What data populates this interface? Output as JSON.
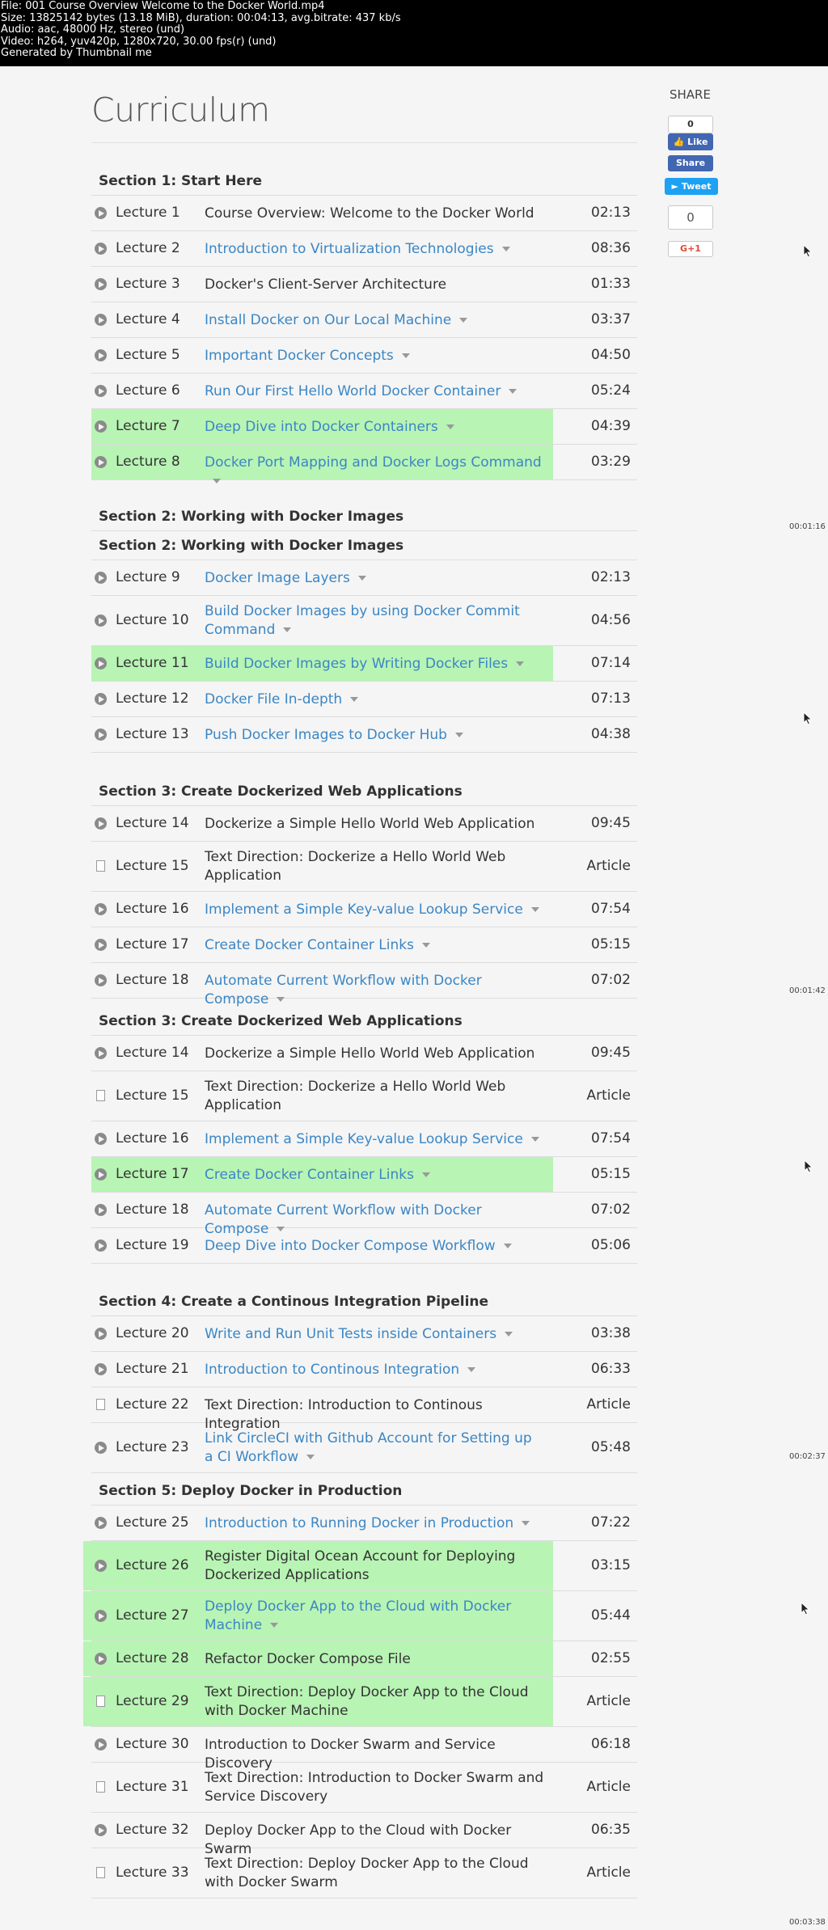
{
  "info": [
    "File: 001 Course Overview Welcome to the Docker World.mp4",
    "Size: 13825142 bytes (13.18 MiB), duration: 00:04:13, avg.bitrate: 437 kb/s",
    "Audio: aac, 48000 Hz, stereo (und)",
    "Video: h264, yuv420p, 1280x720, 30.00 fps(r) (und)",
    "Generated by Thumbnail me"
  ],
  "page_title": "Curriculum",
  "share": {
    "label": "SHARE",
    "fb_count": "0",
    "fb_like": "Like",
    "fb_share": "Share",
    "tweet": "Tweet",
    "gplus_count": "0",
    "gplus": "G+1"
  },
  "timestamps": [
    "00:01:16",
    "00:01:42",
    "00:02:37",
    "00:03:38"
  ],
  "sections": [
    {
      "text": "Section 1: Start Here"
    },
    {
      "text": "Section 2: Working with Docker Images"
    },
    {
      "text": "Section 2: Working with Docker Images"
    },
    {
      "text": "Section 3: Create Dockerized Web Applications"
    },
    {
      "text": "Section 3: Create Dockerized Web Applications"
    },
    {
      "text": "Section 4: Create a Continous Integration Pipeline"
    },
    {
      "text": "Section 5: Deploy Docker in Production"
    }
  ],
  "rows": [
    {
      "lecture": "Lecture 1",
      "title": "Course Overview: Welcome to the Docker World",
      "duration": "02:13",
      "link": false,
      "type": "video"
    },
    {
      "lecture": "Lecture 2",
      "title": "Introduction to Virtualization Technologies",
      "duration": "08:36",
      "link": true,
      "type": "video"
    },
    {
      "lecture": "Lecture 3",
      "title": "Docker's Client-Server Architecture",
      "duration": "01:33",
      "link": false,
      "type": "video"
    },
    {
      "lecture": "Lecture 4",
      "title": "Install Docker on Our Local Machine",
      "duration": "03:37",
      "link": true,
      "type": "video"
    },
    {
      "lecture": "Lecture 5",
      "title": "Important Docker Concepts",
      "duration": "04:50",
      "link": true,
      "type": "video"
    },
    {
      "lecture": "Lecture 6",
      "title": "Run Our First Hello World Docker Container",
      "duration": "05:24",
      "link": true,
      "type": "video"
    },
    {
      "lecture": "Lecture 7",
      "title": "Deep Dive into Docker Containers",
      "duration": "04:39",
      "link": true,
      "type": "video"
    },
    {
      "lecture": "Lecture 8",
      "title": "Docker Port Mapping and Docker Logs Command",
      "duration": "03:29",
      "link": true,
      "type": "video"
    },
    {
      "lecture": "Lecture 9",
      "title": "Docker Image Layers",
      "duration": "02:13",
      "link": true,
      "type": "video"
    },
    {
      "lecture": "Lecture 10",
      "title": "Build Docker Images by using Docker Commit Command",
      "duration": "04:56",
      "link": true,
      "type": "video"
    },
    {
      "lecture": "Lecture 11",
      "title": "Build Docker Images by Writing Docker Files",
      "duration": "07:14",
      "link": true,
      "type": "video"
    },
    {
      "lecture": "Lecture 12",
      "title": "Docker File In-depth",
      "duration": "07:13",
      "link": true,
      "type": "video"
    },
    {
      "lecture": "Lecture 13",
      "title": "Push Docker Images to Docker Hub",
      "duration": "04:38",
      "link": true,
      "type": "video"
    },
    {
      "lecture": "Lecture 14",
      "title": "Dockerize a Simple Hello World Web Application",
      "duration": "09:45",
      "link": false,
      "type": "video"
    },
    {
      "lecture": "Lecture 15",
      "title": "Text Direction: Dockerize a Hello World Web Application",
      "duration": "Article",
      "link": false,
      "type": "article"
    },
    {
      "lecture": "Lecture 16",
      "title": "Implement a Simple Key-value Lookup Service",
      "duration": "07:54",
      "link": true,
      "type": "video"
    },
    {
      "lecture": "Lecture 17",
      "title": "Create Docker Container Links",
      "duration": "05:15",
      "link": true,
      "type": "video"
    },
    {
      "lecture": "Lecture 18",
      "title": "Automate Current Workflow with Docker Compose",
      "duration": "07:02",
      "link": true,
      "type": "video"
    },
    {
      "lecture": "Lecture 14",
      "title": "Dockerize a Simple Hello World Web Application",
      "duration": "09:45",
      "link": false,
      "type": "video"
    },
    {
      "lecture": "Lecture 15",
      "title": "Text Direction: Dockerize a Hello World Web Application",
      "duration": "Article",
      "link": false,
      "type": "article"
    },
    {
      "lecture": "Lecture 16",
      "title": "Implement a Simple Key-value Lookup Service",
      "duration": "07:54",
      "link": true,
      "type": "video"
    },
    {
      "lecture": "Lecture 17",
      "title": "Create Docker Container Links",
      "duration": "05:15",
      "link": true,
      "type": "video"
    },
    {
      "lecture": "Lecture 18",
      "title": "Automate Current Workflow with Docker Compose",
      "duration": "07:02",
      "link": true,
      "type": "video"
    },
    {
      "lecture": "Lecture 19",
      "title": "Deep Dive into Docker Compose Workflow",
      "duration": "05:06",
      "link": true,
      "type": "video"
    },
    {
      "lecture": "Lecture 20",
      "title": "Write and Run Unit Tests inside Containers",
      "duration": "03:38",
      "link": true,
      "type": "video"
    },
    {
      "lecture": "Lecture 21",
      "title": "Introduction to Continous Integration",
      "duration": "06:33",
      "link": true,
      "type": "video"
    },
    {
      "lecture": "Lecture 22",
      "title": "Text Direction: Introduction to Continous Integration",
      "duration": "Article",
      "link": false,
      "type": "article"
    },
    {
      "lecture": "Lecture 23",
      "title": "Link CircleCI with Github Account for Setting up a CI Workflow",
      "duration": "05:48",
      "link": true,
      "type": "video"
    },
    {
      "lecture": "Lecture 25",
      "title": "Introduction to Running Docker in Production",
      "duration": "07:22",
      "link": true,
      "type": "video"
    },
    {
      "lecture": "Lecture 26",
      "title": "Register Digital Ocean Account for Deploying Dockerized Applications",
      "duration": "03:15",
      "link": false,
      "type": "video"
    },
    {
      "lecture": "Lecture 27",
      "title": "Deploy Docker App to the Cloud with Docker Machine",
      "duration": "05:44",
      "link": true,
      "type": "video"
    },
    {
      "lecture": "Lecture 28",
      "title": "Refactor Docker Compose File",
      "duration": "02:55",
      "link": false,
      "type": "video"
    },
    {
      "lecture": "Lecture 29",
      "title": "Text Direction: Deploy Docker App to the Cloud with Docker Machine",
      "duration": "Article",
      "link": false,
      "type": "article"
    },
    {
      "lecture": "Lecture 30",
      "title": "Introduction to Docker Swarm and Service Discovery",
      "duration": "06:18",
      "link": false,
      "type": "video"
    },
    {
      "lecture": "Lecture 31",
      "title": "Text Direction: Introduction to Docker Swarm and Service Discovery",
      "duration": "Article",
      "link": false,
      "type": "article"
    },
    {
      "lecture": "Lecture 32",
      "title": "Deploy Docker App to the Cloud with Docker Swarm",
      "duration": "06:35",
      "link": false,
      "type": "video"
    },
    {
      "lecture": "Lecture 33",
      "title": "Text Direction: Deploy Docker App to the Cloud with Docker Swarm",
      "duration": "Article",
      "link": false,
      "type": "article"
    }
  ],
  "highlight_color": "#b8f4b4",
  "link_color": "#3b86c4"
}
